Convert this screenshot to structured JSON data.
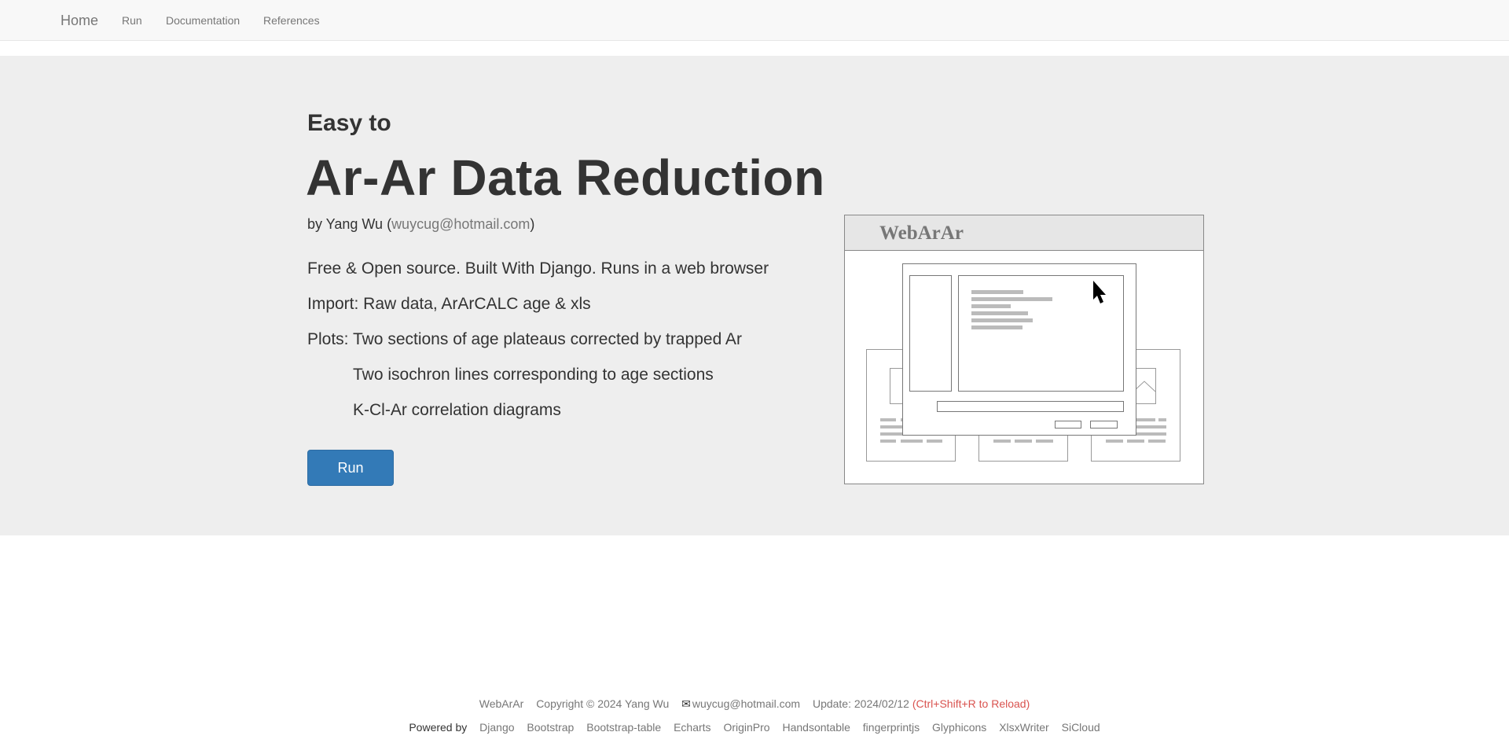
{
  "nav": {
    "brand": "Home",
    "links": [
      "Run",
      "Documentation",
      "References"
    ]
  },
  "hero": {
    "subtitle": "Easy to",
    "title": "Ar-Ar Data Reduction",
    "byline_prefix": "by Yang Wu (",
    "email": "wuycug@hotmail.com",
    "byline_suffix": ")",
    "features": [
      "Free & Open source. Built With Django. Runs in a web browser",
      "Import: Raw data, ArArCALC age & xls",
      "Plots: Two sections of age plateaus corrected by trapped Ar",
      "Two isochron lines corresponding to age sections",
      "K-Cl-Ar correlation diagrams"
    ],
    "run_button": "Run"
  },
  "illustration": {
    "window_title": "WebArAr"
  },
  "footer": {
    "app": "WebArAr",
    "copyright": "Copyright © 2024 Yang Wu",
    "envelope_icon": "✉",
    "email": "wuycug@hotmail.com",
    "update": "Update: 2024/02/12",
    "reload_hint": "(Ctrl+Shift+R to Reload)",
    "powered_by": "Powered by",
    "libraries": [
      "Django",
      "Bootstrap",
      "Bootstrap-table",
      "Echarts",
      "OriginPro",
      "Handsontable",
      "fingerprintjs",
      "Glyphicons",
      "XlsxWriter",
      "SiCloud"
    ]
  }
}
